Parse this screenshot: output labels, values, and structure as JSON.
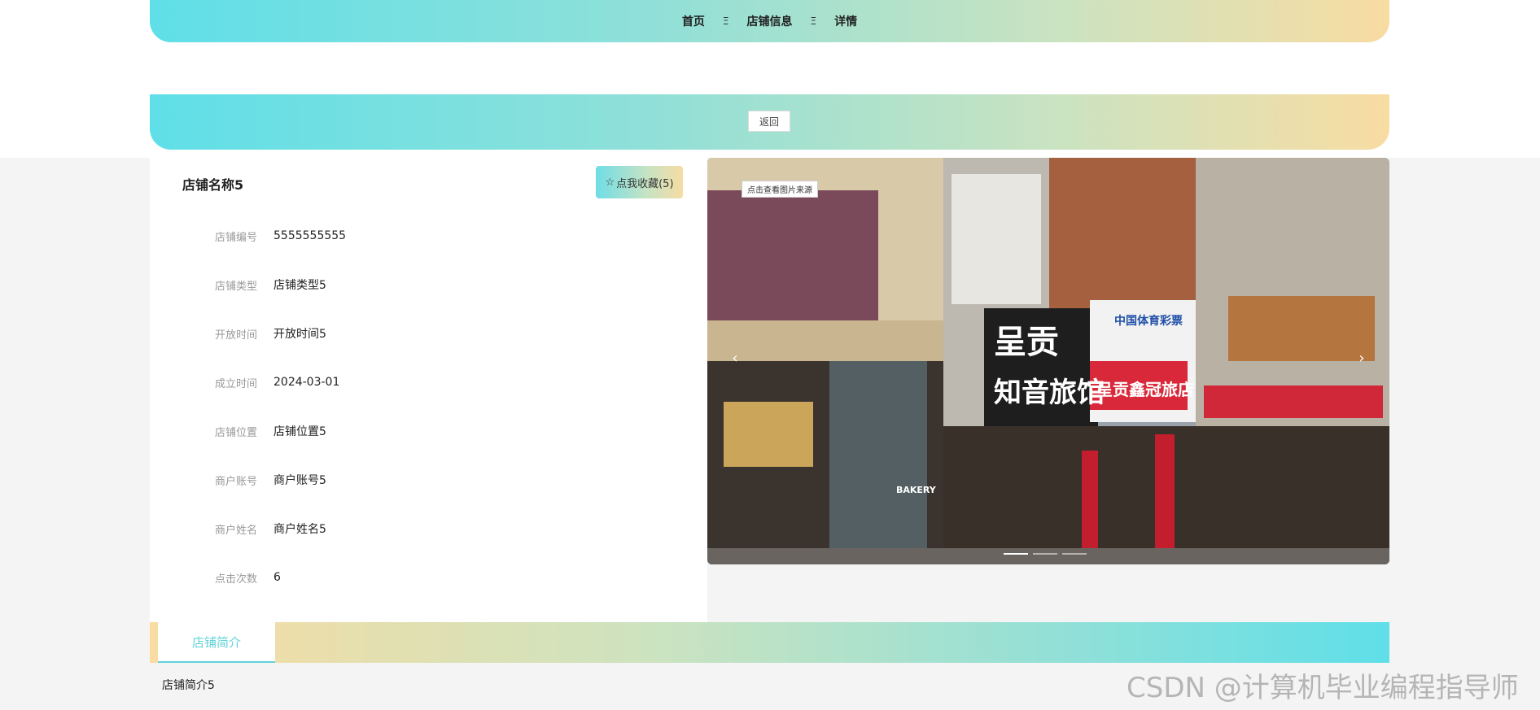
{
  "nav": {
    "breadcrumb": [
      "首页",
      "店铺信息",
      "详情"
    ],
    "separator": "Ξ"
  },
  "back_label": "返回",
  "shop": {
    "title": "店铺名称5",
    "favorite_label": "点我收藏(5)",
    "favorite_icon": "star-outline-icon",
    "fields": [
      {
        "label": "店铺编号",
        "value": "5555555555"
      },
      {
        "label": "店铺类型",
        "value": "店铺类型5"
      },
      {
        "label": "开放时间",
        "value": "开放时间5"
      },
      {
        "label": "成立时间",
        "value": "2024-03-01"
      },
      {
        "label": "店铺位置",
        "value": "店铺位置5"
      },
      {
        "label": "商户账号",
        "value": "商户账号5"
      },
      {
        "label": "商户姓名",
        "value": "商户姓名5"
      },
      {
        "label": "点击次数",
        "value": "6"
      }
    ]
  },
  "carousel": {
    "source_tip": "点击查看图片来源",
    "signs": [
      "呈贡",
      "知音旅馆",
      "中国体育彩票",
      "呈贡鑫冠旅店",
      "BAKERY"
    ],
    "slide_count": 3,
    "active_index": 0
  },
  "tabs": [
    {
      "label": "店铺简介"
    }
  ],
  "intro": "店铺简介5",
  "watermark": "CSDN @计算机毕业编程指导师",
  "colors": {
    "gradient_start": "#5fdfe8",
    "gradient_end": "#f8dca2",
    "tab_accent": "#5fd3d8"
  }
}
